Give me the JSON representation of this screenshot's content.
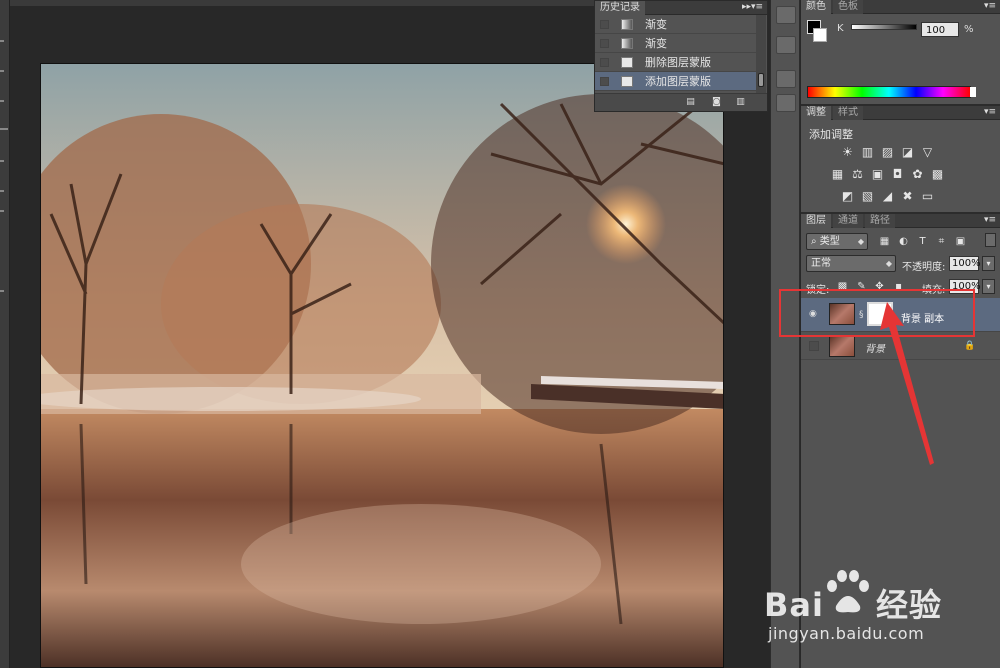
{
  "history_panel": {
    "tab": "历史记录",
    "items": [
      {
        "label": "渐变",
        "icon": "gradient-icon",
        "selected": false
      },
      {
        "label": "渐变",
        "icon": "gradient-icon",
        "selected": false
      },
      {
        "label": "删除图层蒙版",
        "icon": "document-icon",
        "selected": false
      },
      {
        "label": "添加图层蒙版",
        "icon": "document-icon",
        "selected": true
      }
    ],
    "footer_icons": [
      "new-document-icon",
      "camera-icon",
      "trash-icon"
    ]
  },
  "color_panel": {
    "tabs": [
      "颜色",
      "色板"
    ],
    "channel": "K",
    "value": "100",
    "unit": "%"
  },
  "adjust_panel": {
    "tabs": [
      "调整",
      "样式"
    ],
    "title": "添加调整"
  },
  "layers_panel": {
    "tabs": [
      "图层",
      "通道",
      "路径"
    ],
    "filter": "类型",
    "blend_mode": "正常",
    "opacity_label": "不透明度:",
    "opacity_value": "100%",
    "lock_label": "锁定:",
    "fill_label": "填充:",
    "fill_value": "100%",
    "layers": [
      {
        "name": "背景 副本",
        "visible": true,
        "has_mask": true,
        "selected": true
      },
      {
        "name": "背景",
        "visible": false,
        "locked": true,
        "italic": true
      }
    ]
  },
  "watermark": {
    "brand": "Bai",
    "brand_suffix": "经验",
    "url": "jingyan.baidu.com"
  },
  "colors": {
    "highlight_box": "#e53535",
    "selection": "#5c6a80"
  }
}
